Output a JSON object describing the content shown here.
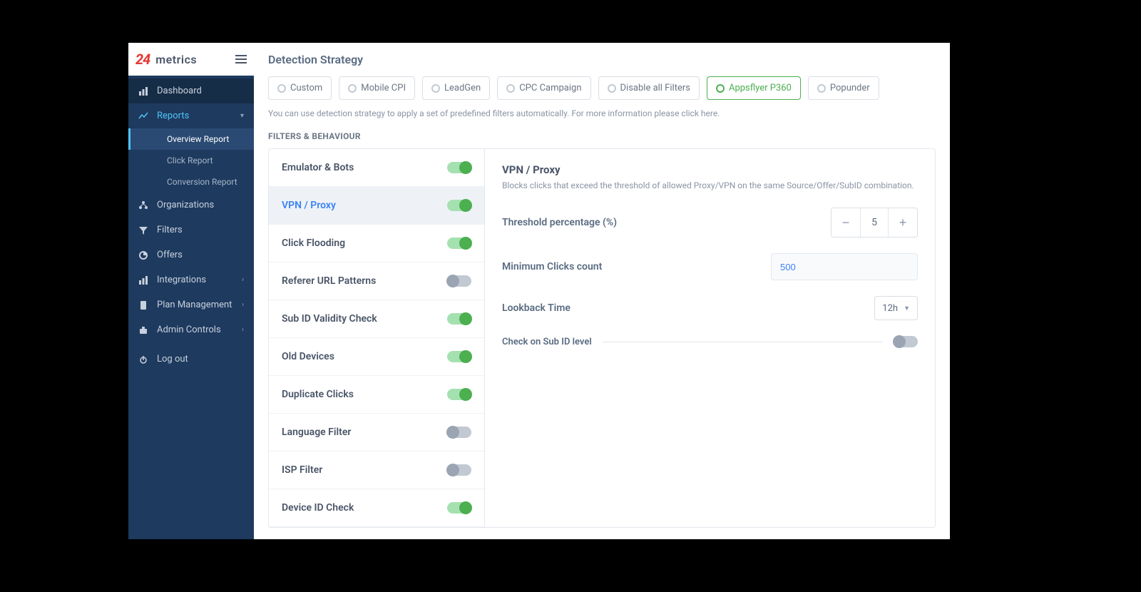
{
  "brand": {
    "logo": "24",
    "text": "metrics"
  },
  "sidebar": {
    "items": [
      {
        "label": "Dashboard"
      },
      {
        "label": "Reports",
        "children": [
          {
            "label": "Overview Report",
            "selected": true
          },
          {
            "label": "Click Report"
          },
          {
            "label": "Conversion Report"
          }
        ]
      },
      {
        "label": "Organizations"
      },
      {
        "label": "Filters"
      },
      {
        "label": "Offers"
      },
      {
        "label": "Integrations",
        "expandable": true
      },
      {
        "label": "Plan Management",
        "expandable": true
      },
      {
        "label": "Admin Controls",
        "expandable": true
      },
      {
        "label": "Log out"
      }
    ]
  },
  "page": {
    "title": "Detection Strategy",
    "hint": "You can use detection strategy to apply a set of predefined filters automatically. For more information please click here.",
    "section_label": "FILTERS & BEHAVIOUR",
    "strategies": [
      {
        "label": "Custom"
      },
      {
        "label": "Mobile CPI"
      },
      {
        "label": "LeadGen"
      },
      {
        "label": "CPC Campaign"
      },
      {
        "label": "Disable all Filters"
      },
      {
        "label": "Appsflyer P360",
        "active": true
      },
      {
        "label": "Popunder"
      }
    ],
    "filters": [
      {
        "name": "Emulator & Bots",
        "on": true
      },
      {
        "name": "VPN / Proxy",
        "on": true,
        "selected": true
      },
      {
        "name": "Click Flooding",
        "on": true
      },
      {
        "name": "Referer URL Patterns",
        "on": false
      },
      {
        "name": "Sub ID Validity Check",
        "on": true
      },
      {
        "name": "Old Devices",
        "on": true
      },
      {
        "name": "Duplicate Clicks",
        "on": true
      },
      {
        "name": "Language Filter",
        "on": false
      },
      {
        "name": "ISP Filter",
        "on": false
      },
      {
        "name": "Device ID Check",
        "on": true
      }
    ],
    "detail": {
      "title": "VPN / Proxy",
      "desc": "Blocks clicks that exceed the threshold of allowed Proxy/VPN on the same Source/Offer/SubID combination.",
      "threshold_label": "Threshold percentage (%)",
      "threshold_value": "5",
      "min_clicks_label": "Minimum Clicks count",
      "min_clicks_value": "500",
      "lookback_label": "Lookback Time",
      "lookback_value": "12h",
      "subid_label": "Check on Sub ID level",
      "subid_on": false
    }
  }
}
